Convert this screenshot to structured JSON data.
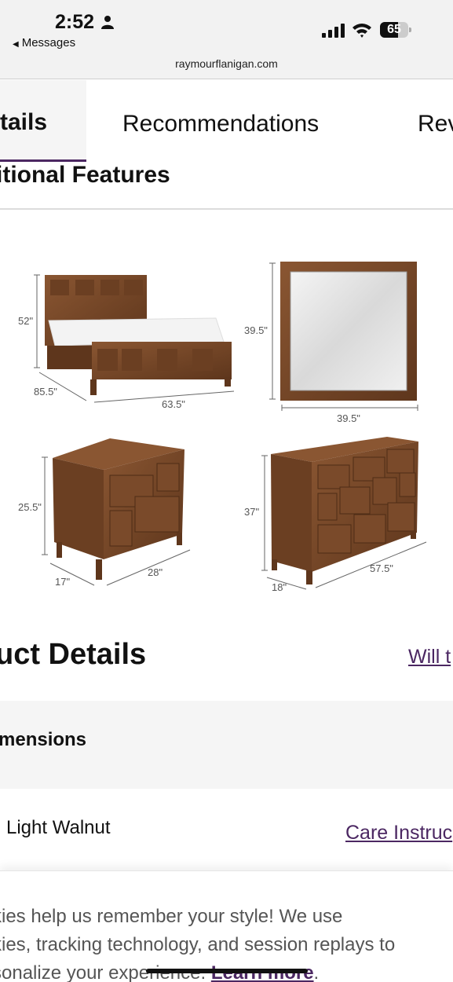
{
  "status_bar": {
    "time": "2:52",
    "back_label": "Messages",
    "battery_level": "65",
    "icons": [
      "person-icon",
      "signal-icon",
      "wifi-icon",
      "battery-icon"
    ]
  },
  "browser": {
    "url": "raymourflanigan.com"
  },
  "tabs": [
    {
      "label": "tails",
      "active": true
    },
    {
      "label": "Recommendations",
      "active": false
    },
    {
      "label": "Rev",
      "active": false
    }
  ],
  "sections": {
    "additional_features_title": "itional Features",
    "product_details_title": "uct Details",
    "will_link": "Will t",
    "dimensions_label": "mensions",
    "color_value": "Light Walnut",
    "care_link": "Care Instruc"
  },
  "diagram": {
    "bed": {
      "height": "52\"",
      "depth": "85.5\"",
      "width": "63.5\""
    },
    "mirror": {
      "height": "39.5\"",
      "width": "39.5\""
    },
    "nightstand": {
      "height": "25.5\"",
      "depth": "17\"",
      "width": "28\""
    },
    "dresser": {
      "height": "37\"",
      "depth": "18\"",
      "width": "57.5\""
    }
  },
  "cookie_banner": {
    "line1": "kies help us remember your style! We use",
    "line2": "kies, tracking technology, and session replays to",
    "line3_prefix": "sonalize your experience. ",
    "learn_more": "Learn more",
    "line3_suffix": "."
  },
  "colors": {
    "brand_purple": "#4b2762",
    "wood": "#7a4a2a"
  }
}
